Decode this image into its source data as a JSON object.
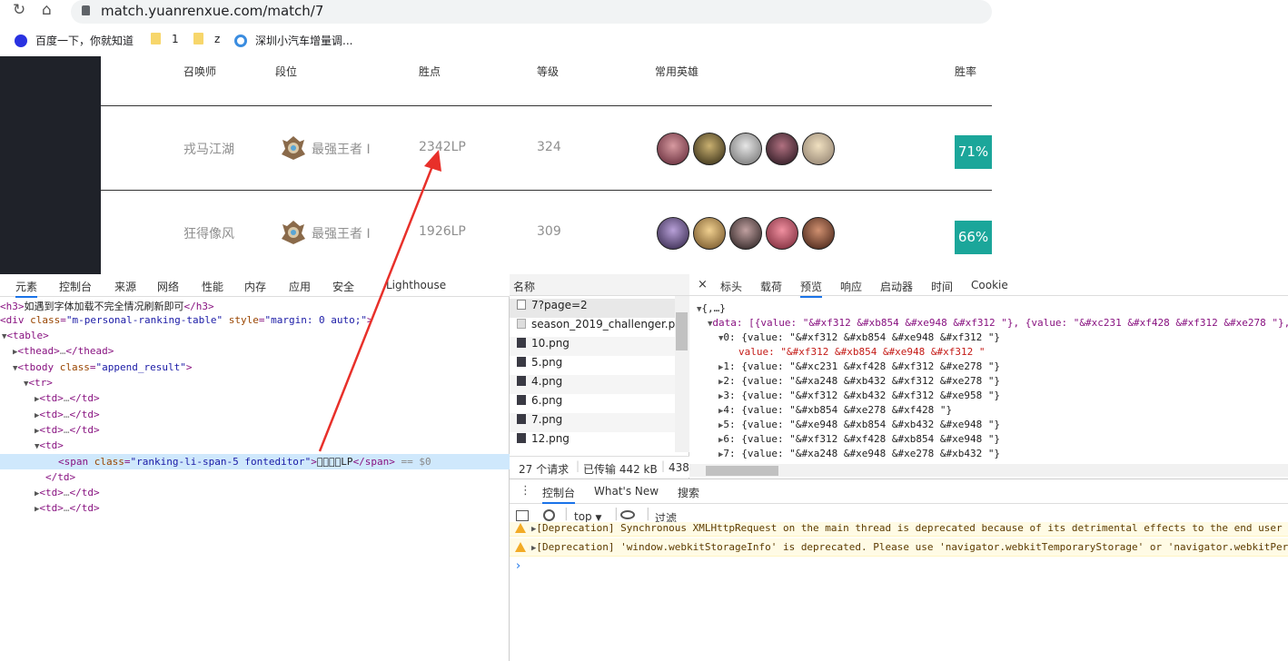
{
  "browser": {
    "url": "match.yuanrenxue.com/match/7",
    "bookmarks": [
      {
        "label": "百度一下，你就知道",
        "icon": "baidu-paw-icon"
      },
      {
        "label": "1",
        "icon": "folder-icon"
      },
      {
        "label": "z",
        "icon": "folder-icon"
      },
      {
        "label": "深圳小汽车增量调...",
        "icon": "globe-icon"
      }
    ]
  },
  "table": {
    "headers": [
      "召唤师",
      "段位",
      "胜点",
      "等级",
      "常用英雄",
      "胜率"
    ],
    "rows": [
      {
        "name": "戎马江湖",
        "rank": "最强王者 I",
        "lp": "2342LP",
        "level": "324",
        "winrate": "71%"
      },
      {
        "name": "狂得像风",
        "rank": "最强王者 I",
        "lp": "1926LP",
        "level": "309",
        "winrate": "66%"
      }
    ],
    "accent_color": "#1ba69a"
  },
  "devtools": {
    "tabs": [
      "元素",
      "控制台",
      "来源",
      "网络",
      "性能",
      "内存",
      "应用",
      "安全",
      "Lighthouse"
    ],
    "active_tab": "元素",
    "dom": {
      "h3_text": "如遇到字体加载不完全情况刷新即可",
      "div_class": "m-personal-ranking-table",
      "div_style": "margin: 0 auto;",
      "tbody_class": "append_result",
      "span_class": "ranking-li-span-5 fonteditor",
      "span_text": "\u0000\u0000\u0000\u0000LP",
      "selected_marker": "== $0"
    },
    "network": {
      "column": "名称",
      "requests": [
        "7?page=2",
        "season_2019_challenger.png",
        "10.png",
        "5.png",
        "4.png",
        "6.png",
        "7.png",
        "12.png"
      ],
      "summary": [
        "27 个请求",
        "已传输 442 kB",
        "438"
      ]
    },
    "preview": {
      "tabs": [
        "标头",
        "载荷",
        "预览",
        "响应",
        "启动器",
        "时间",
        "Cookie"
      ],
      "active_tab": "预览",
      "lines": [
        "{,…}",
        "data: [{value: \"&#xf312 &#xb854 &#xe948 &#xf312 \"}, {value: \"&#xc231 &#xf428 &#xf312 &#xe278 \"},",
        "0: {value: \"&#xf312 &#xb854 &#xe948 &#xf312 \"}",
        "value: \"&#xf312 &#xb854 &#xe948 &#xf312 \"",
        "1: {value: \"&#xc231 &#xf428 &#xf312 &#xe278 \"}",
        "2: {value: \"&#xa248 &#xb432 &#xf312 &#xe278 \"}",
        "3: {value: \"&#xf312 &#xb432 &#xf312 &#xe958 \"}",
        "4: {value: \"&#xb854 &#xe278 &#xf428 \"}",
        "5: {value: \"&#xe948 &#xb854 &#xb432 &#xe948 \"}",
        "6: {value: \"&#xf312 &#xf428 &#xb854 &#xe948 \"}",
        "7: {value: \"&#xa248 &#xe948 &#xe278 &#xb432 \"}"
      ]
    },
    "drawer": {
      "tabs": [
        "控制台",
        "What's New",
        "搜索"
      ],
      "context": "top",
      "filter_placeholder": "过滤",
      "warnings": [
        "[Deprecation] Synchronous XMLHttpRequest on the main thread is deprecated because of its detrimental effects to the end user",
        "[Deprecation] 'window.webkitStorageInfo' is deprecated. Please use 'navigator.webkitTemporaryStorage' or 'navigator.webkitPer"
      ],
      "prompt": "›"
    }
  }
}
